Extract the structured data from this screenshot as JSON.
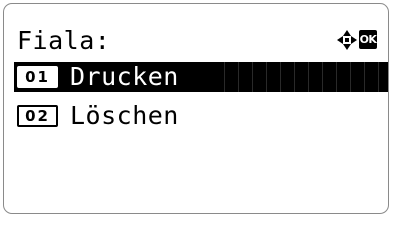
{
  "screen": {
    "title": "Fiala:",
    "ok_label": "OK",
    "nav_icon": "four-way-arrow-icon"
  },
  "menu": {
    "items": [
      {
        "number": "01",
        "label": "Drucken",
        "selected": true
      },
      {
        "number": "02",
        "label": "Löschen",
        "selected": false
      }
    ]
  },
  "colors": {
    "background": "#ffffff",
    "foreground": "#000000",
    "frame": "#8a8a8a"
  }
}
